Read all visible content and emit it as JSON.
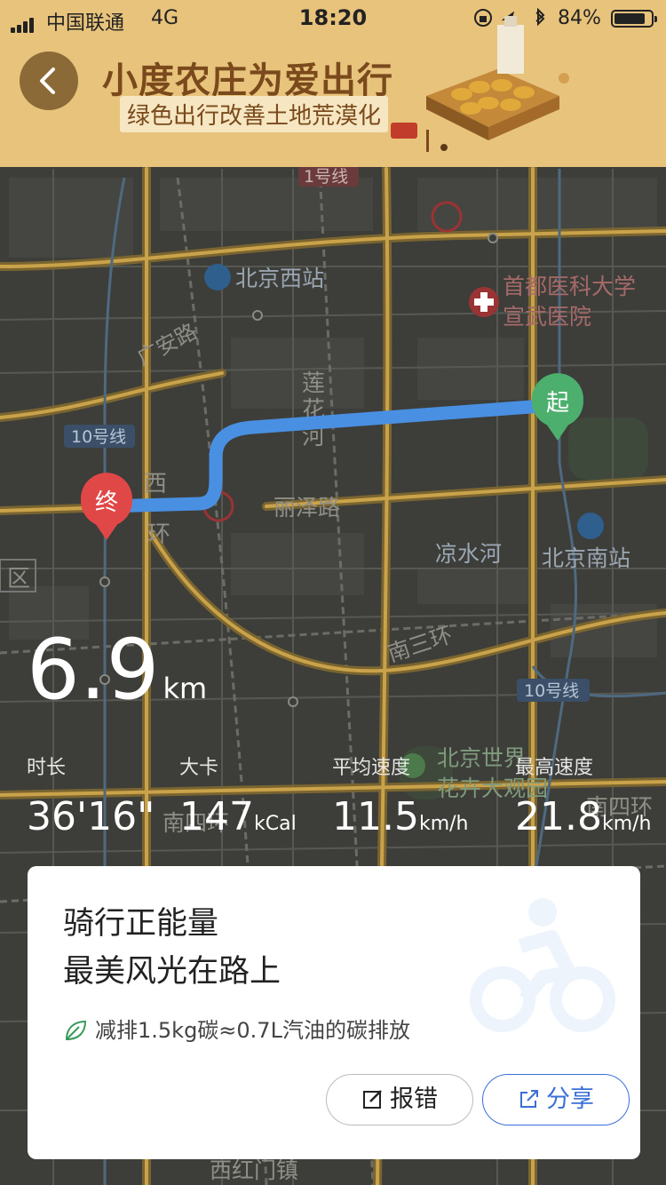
{
  "status_bar": {
    "carrier": "中国联通",
    "network": "4G",
    "time": "18:20",
    "battery_pct": "84%",
    "battery_level": 0.84
  },
  "banner": {
    "title": "小度农庄为爱出行",
    "subtitle": "绿色出行改善土地荒漠化",
    "accent_color": "#e8c37c"
  },
  "map_labels": {
    "line1": "1号线",
    "line10_a": "10号线",
    "line10_b": "10号线",
    "beijing_west": "北京西站",
    "hospital_1": "首都医科大学",
    "hospital_2": "宣武医院",
    "guangan": "广安路",
    "lianhua_1": "莲",
    "lianhua_2": "花",
    "lianhua_3": "河",
    "xi": "西",
    "huan": "环",
    "lize": "丽泽路",
    "liangshui": "凉水河",
    "beijing_south": "北京南站",
    "nansanhuan": "南三环",
    "expo_1": "北京世界",
    "expo_2": "花卉大观园",
    "nansihuan_w": "南四环",
    "nansihuan_e": "南四环",
    "xihongmen": "西红门镇",
    "district": "区",
    "start_marker": "起",
    "end_marker": "终"
  },
  "trip": {
    "distance": "6.9",
    "distance_unit": "km",
    "stats": [
      {
        "label": "时长",
        "value": "36'16\"",
        "unit": ""
      },
      {
        "label": "大卡",
        "value": "147",
        "unit": "kCal"
      },
      {
        "label": "平均速度",
        "value": "11.5",
        "unit": "km/h"
      },
      {
        "label": "最高速度",
        "value": "21.8",
        "unit": "km/h"
      }
    ]
  },
  "card": {
    "line1": "骑行正能量",
    "line2": "最美风光在路上",
    "co2_text": "减排1.5kg碳≈0.7L汽油的碳排放",
    "report_label": "报错",
    "share_label": "分享",
    "accent_color": "#3a6fd8",
    "route_color": "#4a90e2"
  }
}
